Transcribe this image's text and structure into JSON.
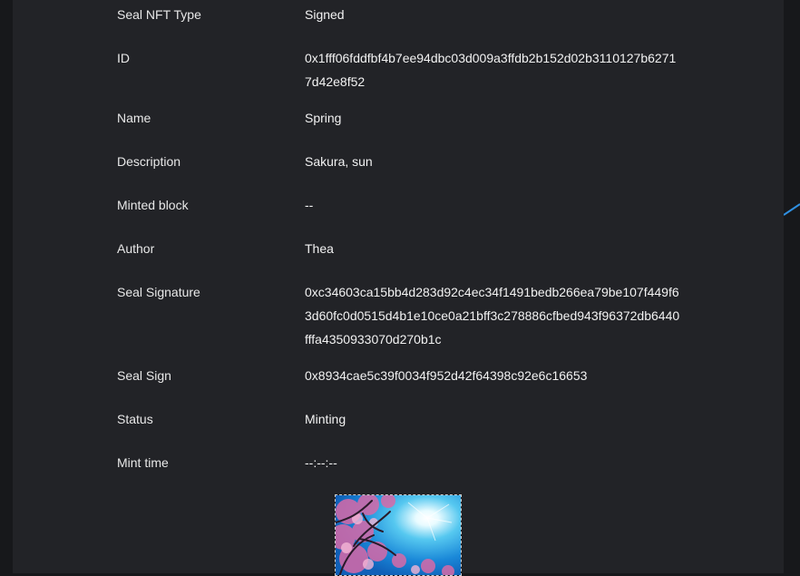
{
  "details": [
    {
      "label": "Seal NFT Type",
      "value": "Signed"
    },
    {
      "label": "ID",
      "value": "0x1fff06fddfbf4b7ee94dbc03d009a3ffdb2b152d02b3110127b6271 7d42e8f52"
    },
    {
      "label": "Name",
      "value": "Spring"
    },
    {
      "label": "Description",
      "value": "Sakura, sun"
    },
    {
      "label": "Minted block",
      "value": "--"
    },
    {
      "label": "Author",
      "value": "Thea"
    },
    {
      "label": "Seal Signature",
      "value": "0xc34603ca15bb4d283d92c4ec34f1491bedb266ea79be107f449f6 3d60fc0d0515d4b1e10ce0a21bff3c278886cfbed943f96372db6440 fffa4350933070d270b1c"
    },
    {
      "label": "Seal Sign",
      "value": "0x8934cae5c39f0034f952d42f64398c92e6c16653"
    },
    {
      "label": "Status",
      "value": "Minting"
    },
    {
      "label": "Mint time",
      "value": "--:--:--"
    }
  ],
  "colors": {
    "background": "#17181b",
    "panel": "#222327",
    "accent_line": "#2f8fe0"
  }
}
